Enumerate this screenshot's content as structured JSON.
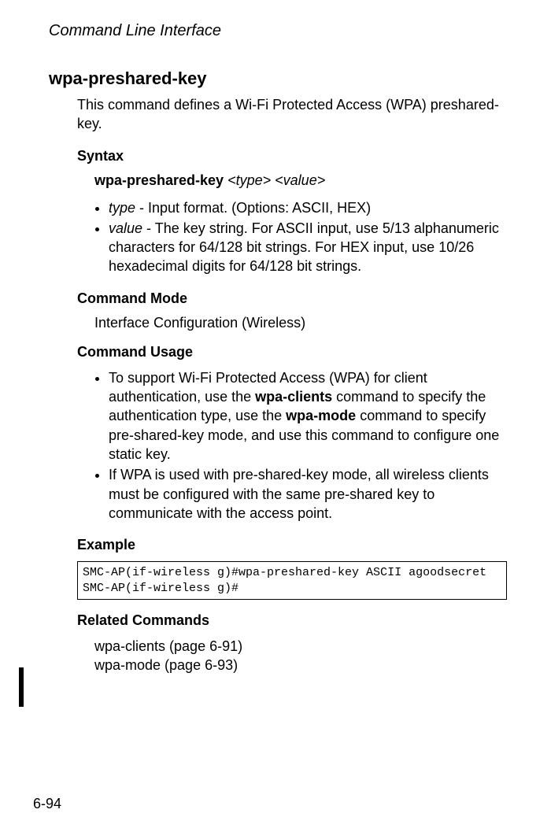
{
  "header": "Command Line Interface",
  "command_title": "wpa-preshared-key",
  "description": "This command defines a Wi-Fi Protected Access (WPA) preshared-key.",
  "syntax_label": "Syntax",
  "syntax_cmd": "wpa-preshared-key",
  "syntax_arg1": "<type>",
  "syntax_arg2": "<value>",
  "param_type_name": "type",
  "param_type_desc": " - Input format. (Options: ASCII, HEX)",
  "param_value_name": "value",
  "param_value_desc": " - The key string. For ASCII input, use 5/13 alphanumeric characters for 64/128 bit strings. For HEX input, use 10/26 hexadecimal digits for 64/128 bit strings.",
  "mode_label": "Command Mode",
  "mode_text": "Interface Configuration (Wireless)",
  "usage_label": "Command Usage",
  "usage_b1_a": "To support Wi-Fi Protected Access (WPA) for client authentication, use the ",
  "usage_b1_cmd1": "wpa-clients",
  "usage_b1_b": " command to specify the authentication type, use the ",
  "usage_b1_cmd2": "wpa-mode",
  "usage_b1_c": " command to specify pre-shared-key mode, and use this command to configure one static key.",
  "usage_b2": "If WPA is used with pre-shared-key mode, all wireless clients must be configured with the same pre-shared key to communicate with the access point.",
  "example_label": "Example",
  "example_code": "SMC-AP(if-wireless g)#wpa-preshared-key ASCII agoodsecret\nSMC-AP(if-wireless g)#",
  "related_label": "Related Commands",
  "related_1": "wpa-clients (page 6-91)",
  "related_2": "wpa-mode (page 6-93)",
  "page_number": "6-94"
}
